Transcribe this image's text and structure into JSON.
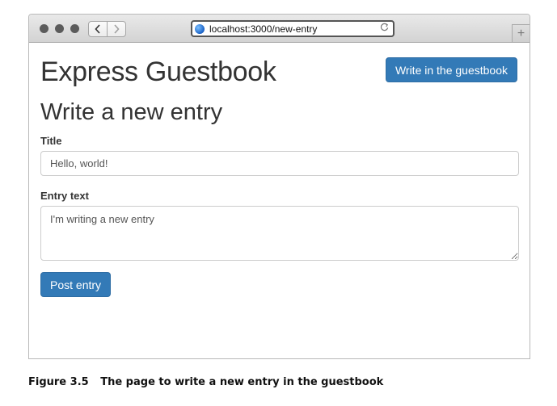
{
  "browser": {
    "url": "localhost:3000/new-entry",
    "back_icon": "chevron-left",
    "forward_icon": "chevron-right",
    "reload_icon": "reload",
    "newtab_label": "+"
  },
  "page": {
    "app_title": "Express Guestbook",
    "nav_button_label": "Write in the guestbook",
    "heading": "Write a new entry",
    "form": {
      "title_label": "Title",
      "title_value": "Hello, world!",
      "entry_label": "Entry text",
      "entry_value": "I'm writing a new entry",
      "submit_label": "Post entry"
    }
  },
  "caption": {
    "number": "Figure 3.5",
    "text": "The page to write a new entry in the guestbook"
  },
  "colors": {
    "primary": "#337ab7",
    "text": "#333333"
  }
}
